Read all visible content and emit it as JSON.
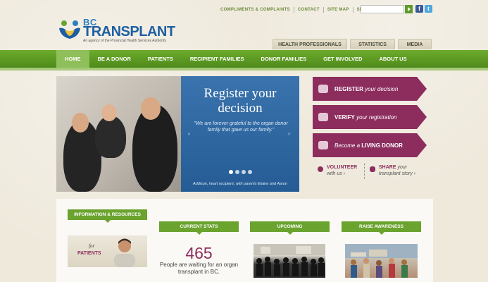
{
  "logo": {
    "bc": "BC",
    "name": "TRANSPLANT",
    "tagline": "An agency of the Provincial Health Services Authority"
  },
  "toplinks": [
    "COMPLIMENTS & COMPLAINTS",
    "CONTACT",
    "SITE MAP",
    "SEARCH"
  ],
  "search": {
    "placeholder": ""
  },
  "social": {
    "facebook": "f",
    "twitter": "t"
  },
  "tabs": [
    "HEALTH PROFESSIONALS",
    "STATISTICS",
    "MEDIA"
  ],
  "nav": [
    "HOME",
    "BE A DONOR",
    "PATIENTS",
    "RECIPIENT FAMILIES",
    "DONOR FAMILIES",
    "GET INVOLVED",
    "ABOUT US"
  ],
  "hero": {
    "title_line1": "Register your",
    "title_line2": "decision",
    "quote": "\"We are forever grateful to the organ donor family that gave us our family.\"",
    "caption": "Addison, heart recipient, with parents Elaine and Aaron",
    "prev": "‹",
    "next": "›"
  },
  "actions": [
    {
      "bold": "REGISTER",
      "italic": "your decision"
    },
    {
      "bold": "VERIFY",
      "italic": "your registration"
    },
    {
      "italic": "Become a",
      "bold": "LIVING DONOR"
    }
  ],
  "mini_links": {
    "volunteer_bold": "VOLUNTEER",
    "volunteer_rest": "with us ›",
    "share_bold": "SHARE",
    "share_italic": "your",
    "share_rest": "transplant story ›"
  },
  "sections": {
    "info": "INFORMATION & RESOURCES",
    "stats": "CURRENT STATS",
    "upcoming": "UPCOMING",
    "awareness": "RAISE AWARENESS"
  },
  "patients_card": {
    "for": "for",
    "label": "PATIENTS"
  },
  "stats": {
    "number": "465",
    "text": "People are waiting for an organ transplant in BC."
  },
  "colors": {
    "green": "#5e9a2a",
    "plum": "#8c2d5e",
    "blue": "#2c5f94"
  }
}
